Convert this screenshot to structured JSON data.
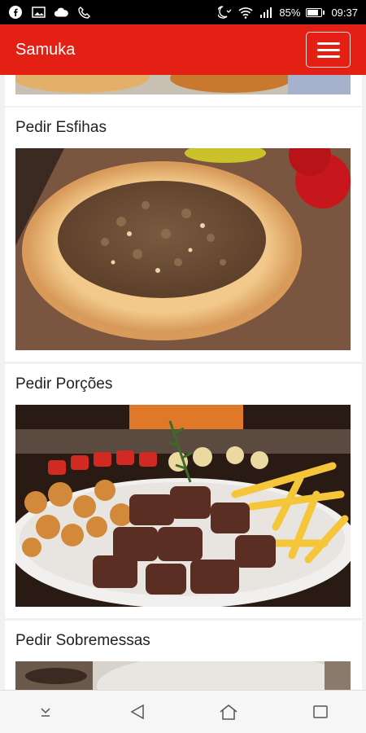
{
  "status_bar": {
    "battery": "85%",
    "battery_level": 0.85,
    "time": "09:37",
    "icons": [
      "facebook-icon",
      "image-icon",
      "cloud-icon",
      "phone-icon",
      "missed-call-icon",
      "wifi-icon",
      "signal-icon",
      "battery-icon"
    ]
  },
  "app_bar": {
    "title": "Samuka",
    "menu_icon": "hamburger-menu-icon",
    "color": "#e41f14"
  },
  "categories": [
    {
      "title": "Pedir Esfihas",
      "image": "esfiha-photo"
    },
    {
      "title": "Pedir Porções",
      "image": "porcoes-photo"
    },
    {
      "title": "Pedir Sobremessas",
      "image": "sobremessas-photo"
    }
  ],
  "nav_bar": {
    "icons": [
      "notification-shade-icon",
      "back-icon",
      "home-icon",
      "recent-apps-icon"
    ]
  }
}
